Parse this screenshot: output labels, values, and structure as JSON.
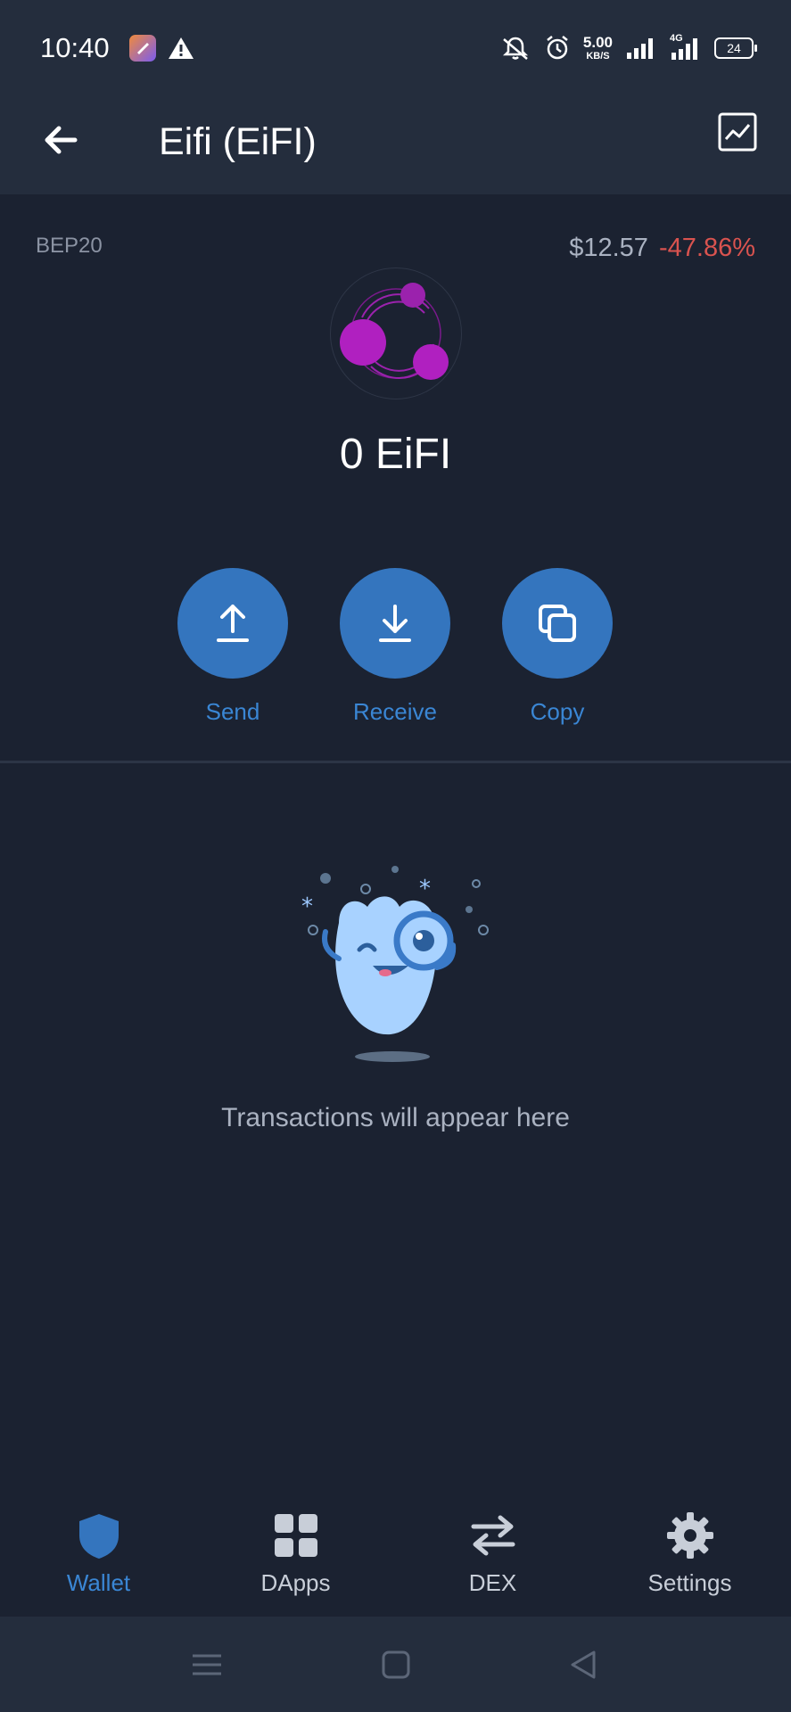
{
  "status_bar": {
    "time": "10:40",
    "net_speed_value": "5.00",
    "net_speed_unit": "KB/S",
    "network_type": "4G",
    "battery_level": "24"
  },
  "header": {
    "title": "Eifi (EiFI)"
  },
  "token": {
    "network": "BEP20",
    "price": "$12.57",
    "change": "-47.86%",
    "balance": "0 EiFI"
  },
  "actions": [
    {
      "label": "Send"
    },
    {
      "label": "Receive"
    },
    {
      "label": "Copy"
    }
  ],
  "empty_state": {
    "message": "Transactions will appear here"
  },
  "bottom_nav": [
    {
      "label": "Wallet",
      "active": true
    },
    {
      "label": "DApps"
    },
    {
      "label": "DEX"
    },
    {
      "label": "Settings"
    }
  ],
  "colors": {
    "background": "#1b2231",
    "header": "#242d3d",
    "accent": "#3475be",
    "accent_text": "#3a86d4",
    "negative": "#d9534f",
    "token_purple": "#b020c0"
  },
  "icons": {
    "back": "arrow-left-icon",
    "chart": "chart-icon",
    "send": "upload-arrow-icon",
    "receive": "download-arrow-icon",
    "copy": "copy-icon",
    "wallet": "shield-icon",
    "dapps": "grid-icon",
    "dex": "swap-arrows-icon",
    "settings": "gear-icon"
  }
}
